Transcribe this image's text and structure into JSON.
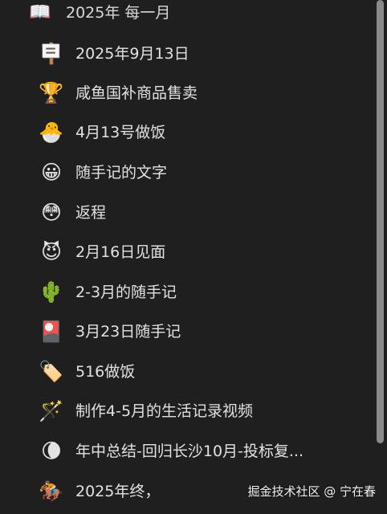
{
  "parent": {
    "icon": "open-book-icon",
    "emoji": "📖",
    "label": "2025年 每一月"
  },
  "items": [
    {
      "icon": "signpost-icon",
      "emoji": "🪧",
      "label": "2025年9月13日"
    },
    {
      "icon": "trophy-icon",
      "emoji": "🏆",
      "label": "咸鱼国补商品售卖"
    },
    {
      "icon": "hatching-chick-icon",
      "emoji": "🐣",
      "label": "4月13号做饭"
    },
    {
      "icon": "grinning-face-icon",
      "emoji": "😀",
      "label": "随手记的文字"
    },
    {
      "icon": "flushed-face-icon",
      "emoji": "😳",
      "label": "返程"
    },
    {
      "icon": "smiling-devil-icon",
      "emoji": "😈",
      "label": "2月16日见面"
    },
    {
      "icon": "cactus-icon",
      "emoji": "🌵",
      "label": "2-3月的随手记"
    },
    {
      "icon": "red-tag-icon",
      "emoji": "🎴",
      "label": "3月23日随手记"
    },
    {
      "icon": "label-tag-icon",
      "emoji": "🏷️",
      "label": "516做饭"
    },
    {
      "icon": "magic-wand-icon",
      "emoji": "🪄",
      "label": "制作4-5月的生活记录视频"
    },
    {
      "icon": "moon-icon",
      "emoji": "🌘",
      "label": "年中总结-回归长沙10月-投标复..."
    },
    {
      "icon": "horse-racing-icon",
      "emoji": "🏇",
      "label": "2025年终，"
    }
  ],
  "watermark": "掘金技术社区 @ 宁在春",
  "colors": {
    "background": "#1f1f1f",
    "text": "#e2e2e2",
    "scrollbar": "#8a8a8a"
  }
}
